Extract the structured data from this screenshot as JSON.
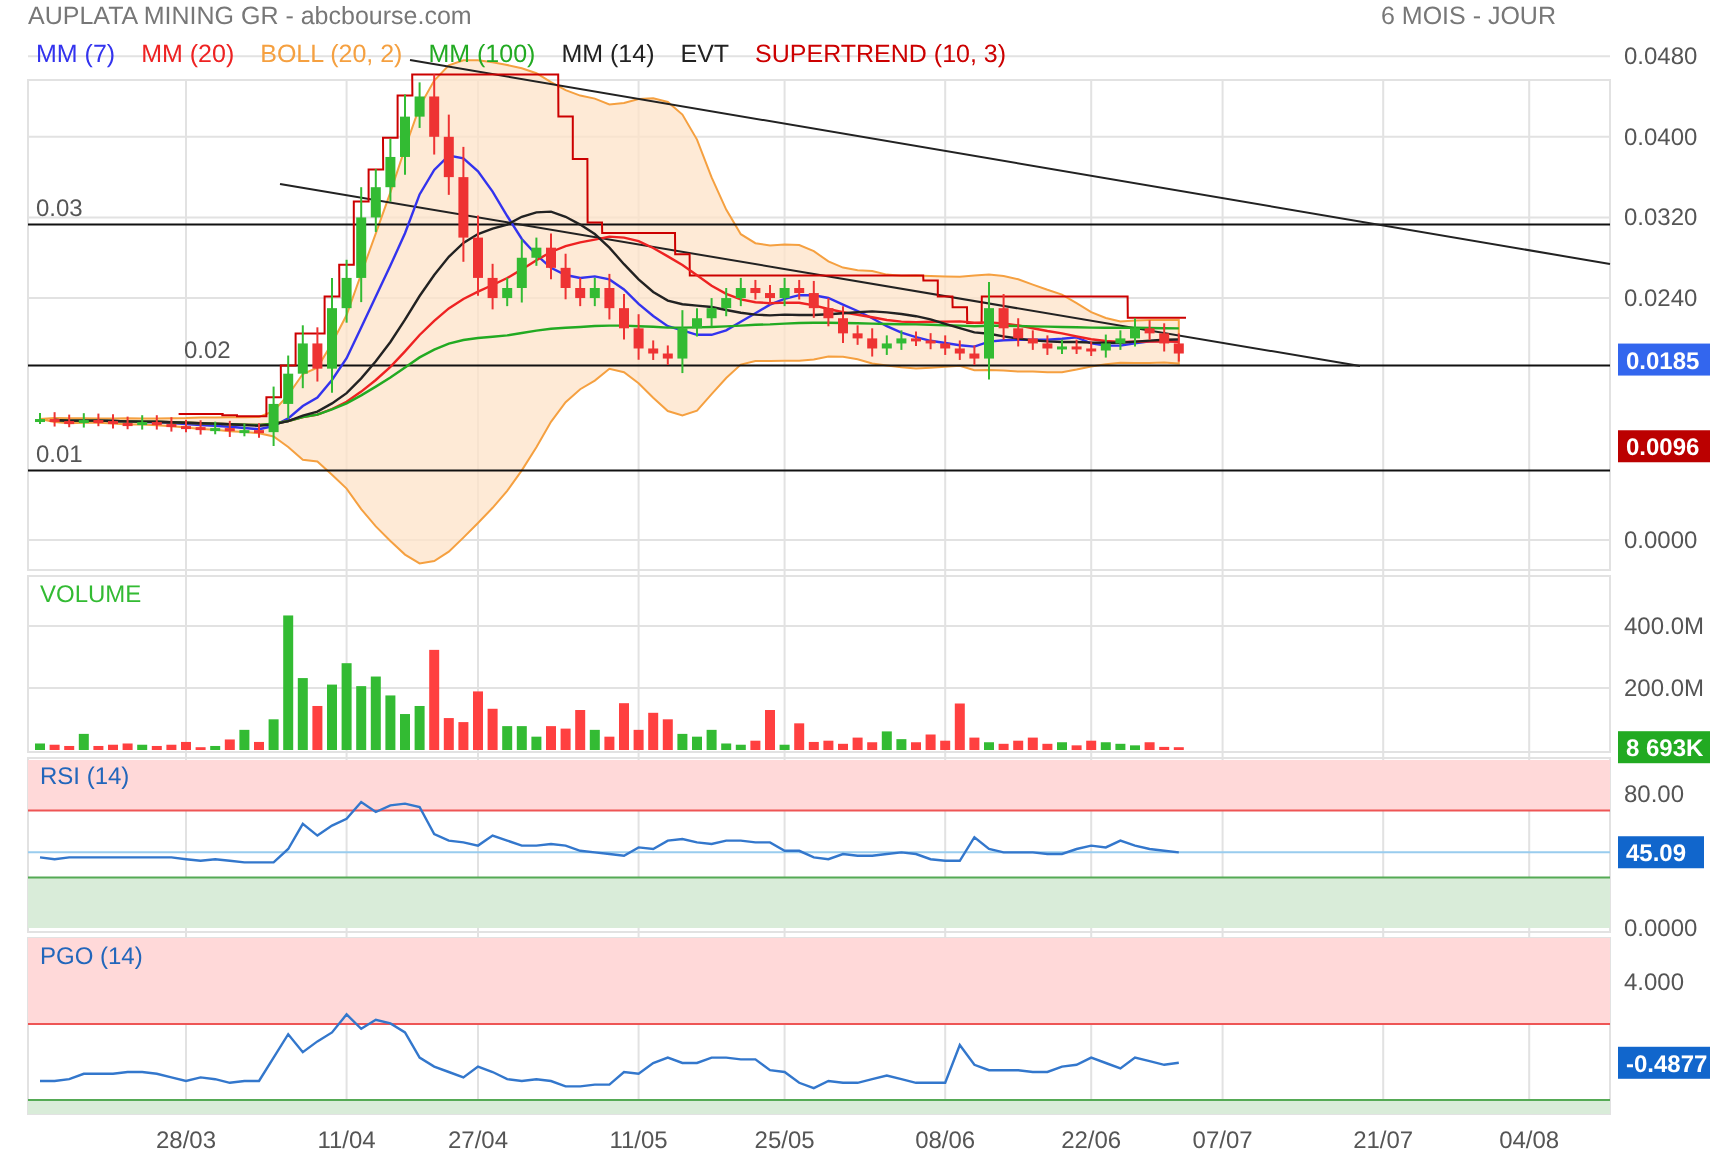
{
  "header": {
    "title": "AUPLATA MINING GR - abcbourse.com",
    "period": "6 MOIS - JOUR"
  },
  "legend": [
    {
      "label": "MM (7)",
      "color": "#3333ee"
    },
    {
      "label": "MM (20)",
      "color": "#ee2222"
    },
    {
      "label": "BOLL (20, 2)",
      "color": "#f5a040"
    },
    {
      "label": "MM (100)",
      "color": "#22aa22"
    },
    {
      "label": "MM (14)",
      "color": "#222222"
    },
    {
      "label": "EVT",
      "color": "#222222"
    },
    {
      "label": "SUPERTREND (10, 3)",
      "color": "#cc0000"
    }
  ],
  "x_axis": {
    "labels": [
      "28/03",
      "11/04",
      "27/04",
      "11/05",
      "25/05",
      "08/06",
      "22/06",
      "07/07",
      "21/07",
      "04/08"
    ]
  },
  "price_panel": {
    "axis_labels": [
      "0.0480",
      "0.0400",
      "0.0320",
      "0.0240",
      "0.0000"
    ],
    "levels": [
      "0.03",
      "0.02",
      "0.01"
    ],
    "tags": [
      {
        "label": "0.0185",
        "color": "#3366ee"
      },
      {
        "label": "0.0096",
        "color": "#bb0000"
      }
    ]
  },
  "volume_panel": {
    "title": "VOLUME",
    "axis_labels": [
      "400.0M",
      "200.0M"
    ],
    "tag": "8 693K"
  },
  "rsi_panel": {
    "title": "RSI (14)",
    "axis_labels": [
      "80.00",
      "0.0000"
    ],
    "tag": "45.09"
  },
  "pgo_panel": {
    "title": "PGO (14)",
    "axis_label": "4.000",
    "tag": "-0.4877"
  }
}
